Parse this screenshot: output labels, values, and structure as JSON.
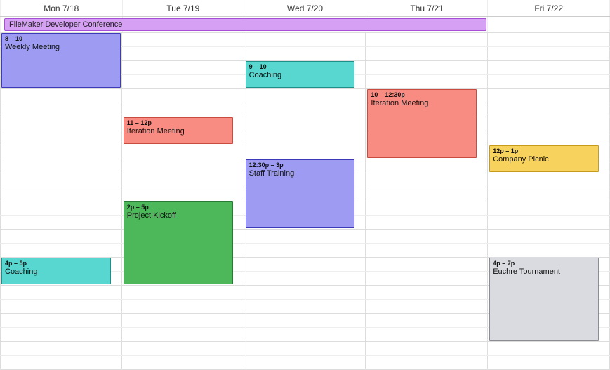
{
  "columns": [
    {
      "label": "Mon 7/18"
    },
    {
      "label": "Tue 7/19"
    },
    {
      "label": "Wed 7/20"
    },
    {
      "label": "Thu 7/21"
    },
    {
      "label": "Fri 7/22"
    }
  ],
  "alldayEvent": {
    "title": "FileMaker Developer Conference",
    "spanColumns": 4
  },
  "gridStartHour": 8,
  "gridEndHour": 20,
  "columnWidth": 173.8,
  "events": [
    {
      "col": 0,
      "startHour": 8,
      "endHour": 10,
      "time": "8 – 10",
      "title": "Weekly Meeting",
      "bg": "#9d9cf2",
      "border": "#3c3ab8",
      "wRatio": 1.0
    },
    {
      "col": 0,
      "startHour": 16,
      "endHour": 17,
      "time": "4p – 5p",
      "title": "Coaching",
      "bg": "#58d6d0",
      "border": "#1f8f8a",
      "wRatio": 0.92
    },
    {
      "col": 1,
      "startHour": 11,
      "endHour": 12,
      "time": "11 – 12p",
      "title": "Iteration Meeting",
      "bg": "#f98c82",
      "border": "#c94a3f",
      "wRatio": 0.92
    },
    {
      "col": 1,
      "startHour": 14,
      "endHour": 17,
      "time": "2p – 5p",
      "title": "Project Kickoff",
      "bg": "#4cb85a",
      "border": "#2a7a35",
      "wRatio": 0.92
    },
    {
      "col": 2,
      "startHour": 9,
      "endHour": 10,
      "time": "9 – 10",
      "title": "Coaching",
      "bg": "#58d6d0",
      "border": "#1f8f8a",
      "wRatio": 0.92
    },
    {
      "col": 2,
      "startHour": 12.5,
      "endHour": 15,
      "time": "12:30p – 3p",
      "title": "Staff Training",
      "bg": "#9d9cf2",
      "border": "#3c3ab8",
      "wRatio": 0.92
    },
    {
      "col": 3,
      "startHour": 10,
      "endHour": 12.5,
      "time": "10 – 12:30p",
      "title": "Iteration Meeting",
      "bg": "#f98c82",
      "border": "#c94a3f",
      "wRatio": 0.92
    },
    {
      "col": 4,
      "startHour": 12,
      "endHour": 13,
      "time": "12p – 1p",
      "title": "Company Picnic",
      "bg": "#f7d25c",
      "border": "#c79a1a",
      "wRatio": 0.92
    },
    {
      "col": 4,
      "startHour": 16,
      "endHour": 19,
      "time": "4p – 7p",
      "title": "Euchre Tournament",
      "bg": "#d9dbe0",
      "border": "#8a8d94",
      "wRatio": 0.92
    }
  ]
}
